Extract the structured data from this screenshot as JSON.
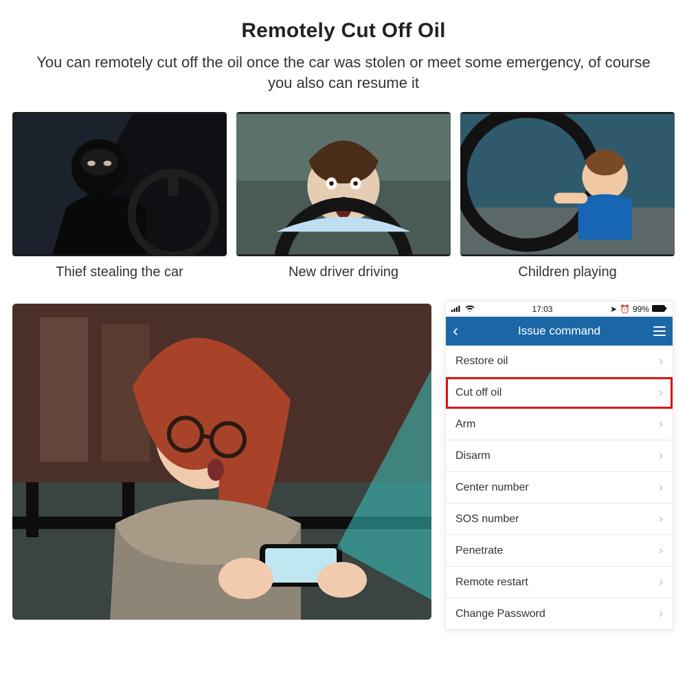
{
  "heading": {
    "title": "Remotely Cut Off Oil",
    "subtitle": "You can remotely cut off the oil once the car was stolen or meet some emergency, of course you also can resume it"
  },
  "scenarios": [
    {
      "caption": "Thief stealing the car"
    },
    {
      "caption": "New driver driving"
    },
    {
      "caption": "Children playing"
    }
  ],
  "phone": {
    "statusbar": {
      "time": "17:03",
      "battery": "99%"
    },
    "navbar_title": "Issue command",
    "commands": [
      {
        "label": "Restore oil",
        "highlight": false
      },
      {
        "label": "Cut off oil",
        "highlight": true
      },
      {
        "label": "Arm",
        "highlight": false
      },
      {
        "label": "Disarm",
        "highlight": false
      },
      {
        "label": "Center number",
        "highlight": false
      },
      {
        "label": "SOS number",
        "highlight": false
      },
      {
        "label": "Penetrate",
        "highlight": false
      },
      {
        "label": "Remote restart",
        "highlight": false
      },
      {
        "label": "Change Password",
        "highlight": false
      }
    ]
  }
}
